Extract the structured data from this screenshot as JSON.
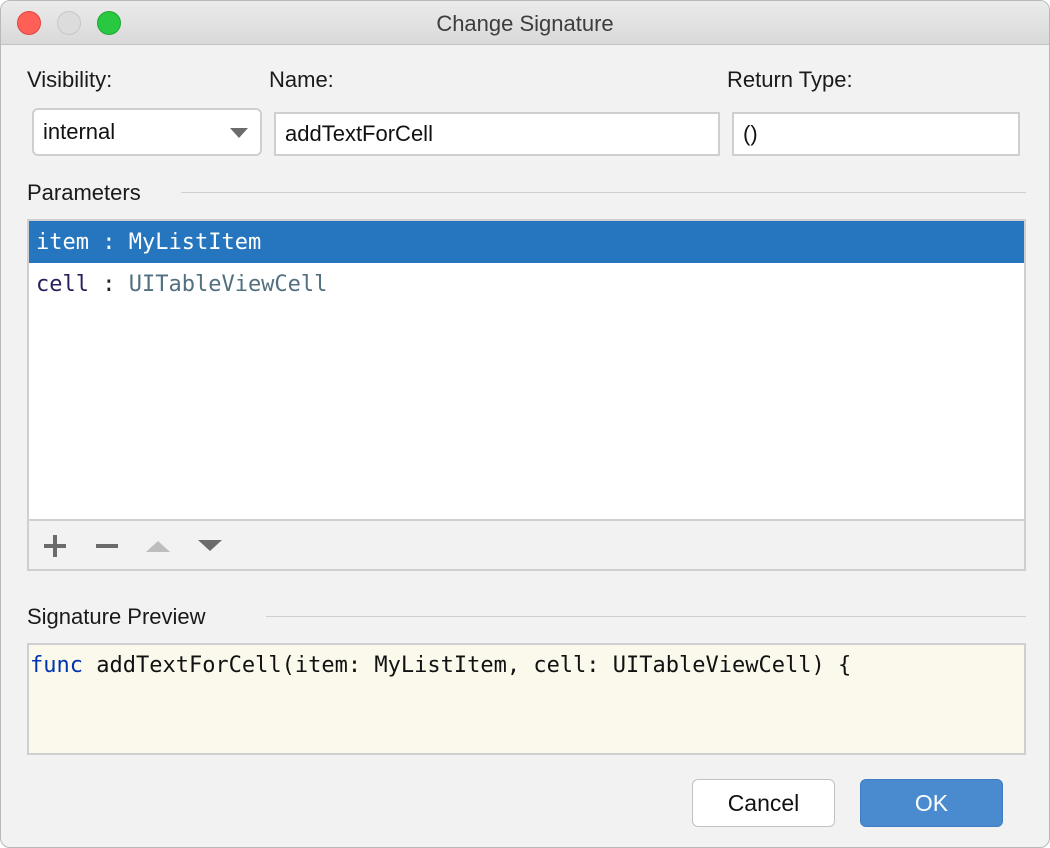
{
  "window": {
    "title": "Change Signature",
    "traffic_lights": {
      "close": "#fe5f57",
      "minimize": "#dcdcdc",
      "zoom": "#28c840"
    }
  },
  "form": {
    "visibility_label": "Visibility:",
    "visibility_value": "internal",
    "name_label": "Name:",
    "name_value": "addTextForCell",
    "return_label": "Return Type:",
    "return_value": "()"
  },
  "parameters": {
    "label": "Parameters",
    "items": [
      {
        "name": "item",
        "sep": " : ",
        "type": "MyListItem",
        "selected": true
      },
      {
        "name": "cell",
        "sep": " : ",
        "type": "UITableViewCell",
        "selected": false
      }
    ],
    "toolbar": {
      "add": "plus-icon",
      "remove": "minus-icon",
      "up": "arrow-up-icon",
      "down": "arrow-down-icon"
    }
  },
  "preview": {
    "label": "Signature Preview",
    "keyword": "func",
    "code": " addTextForCell(item: MyListItem, cell: UITableViewCell) {"
  },
  "buttons": {
    "cancel": "Cancel",
    "ok": "OK"
  },
  "colors": {
    "selection": "#2675bf",
    "ok_button": "#4a8bd0",
    "keyword": "#0033b3",
    "param_name": "#291f5c",
    "param_type": "#527080"
  }
}
